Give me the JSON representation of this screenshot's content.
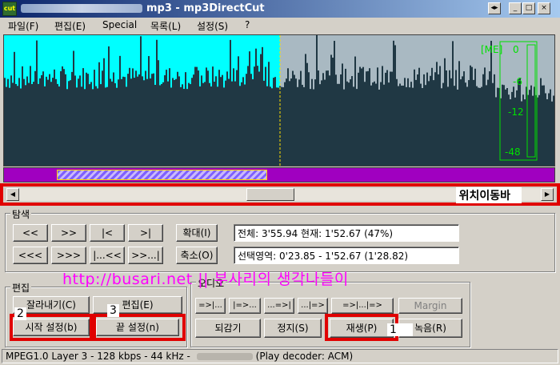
{
  "window": {
    "title": "mp3 - mp3DirectCut",
    "icon": "mp3directcut-app-icon",
    "controls": [
      "◂▸",
      "_",
      "□",
      "×"
    ]
  },
  "menu": [
    "파일(F)",
    "편집(E)",
    "Special",
    "목록(L)",
    "설정(S)",
    "?"
  ],
  "waveform": {
    "played_color": "#00ffff",
    "unplayed_color": "#a9b9c2",
    "wave_color": "#203844",
    "meter_labels": [
      "[ME]",
      "0",
      "-6",
      "-12",
      "-48"
    ],
    "meter_color": "#00e000"
  },
  "timeline": {
    "bar_color": "#a000c0",
    "selection_fraction": [
      0.095,
      0.48
    ]
  },
  "scrollbar": {
    "label": "위치이동바"
  },
  "navigation": {
    "title": "탐색",
    "row1": [
      "<<",
      ">>",
      "|<",
      ">|"
    ],
    "row2": [
      "<<<",
      ">>>",
      "|...<<",
      ">>...|"
    ],
    "zoom_in": "확대(I)",
    "zoom_out": "축소(O)",
    "total_time": "전체: 3'55.94  현재: 1'52.67  (47%)",
    "selection_time": "선택영역: 0'23.85 - 1'52.67 (1'28.82)"
  },
  "edit": {
    "title": "편집",
    "cut": "잘라내기(C)",
    "edit_btn": "편집(E)",
    "set_begin": "시작 설정(b)",
    "set_end": "끝 설정(n)"
  },
  "audio": {
    "title": "오디오",
    "play_row": [
      "=>|...",
      "|=>...",
      "...=>|",
      "...|=>",
      "=>|...|=>"
    ],
    "margin": "Margin",
    "rewind": "되감기",
    "stop": "정지(S)",
    "play": "재생(P)",
    "record": "녹음(R)"
  },
  "annotations": {
    "n1": "1",
    "n2": "2",
    "n3": "3"
  },
  "watermark": "http://busari.net  ||  부사리의 생각나들이",
  "status": {
    "format": "MPEG1.0 Layer 3 - 128 kbps - 44 kHz - ",
    "decoder": "(Play decoder: ACM)"
  }
}
